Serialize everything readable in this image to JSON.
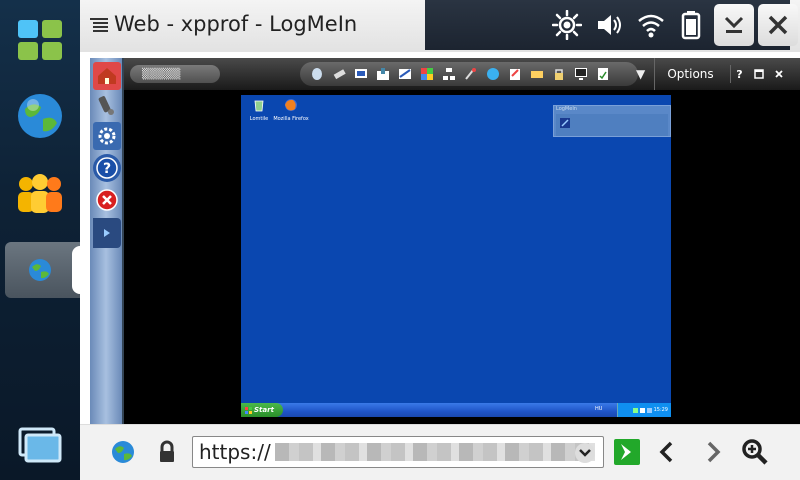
{
  "window": {
    "title": "Web - xpprof - LogMeIn"
  },
  "colors": {
    "xp_desktop": "#0a47b0",
    "xp_start": "#2a8f2a",
    "go_button": "#22a82a"
  },
  "dock": {
    "items": [
      {
        "name": "app-launcher-icon"
      },
      {
        "name": "web-globe-icon"
      },
      {
        "name": "contacts-icon"
      },
      {
        "name": "active-browser-task-icon"
      },
      {
        "name": "task-switcher-icon"
      }
    ]
  },
  "logmein": {
    "host_label": "▒▒▒▒▒",
    "options_label": "Options",
    "help_label": "?",
    "dropdown_glyph": "▼",
    "side_buttons": [
      "home-icon",
      "remote-control-icon",
      "preferences-icon",
      "help-icon",
      "disconnect-icon"
    ],
    "toolbar_icons": [
      "mouse-icon",
      "eraser-icon",
      "screen-icon",
      "zoom-icon",
      "display-icon",
      "color-icon",
      "network-icon",
      "pen-icon",
      "chat-icon",
      "clipboard-icon",
      "keyboard-icon",
      "lock-icon",
      "monitor-icon",
      "notes-icon"
    ]
  },
  "remote": {
    "desktop_icons": [
      {
        "label": "Lomtile"
      },
      {
        "label": "Mozilla Firefox"
      }
    ],
    "window_title": "LogMeIn",
    "start_label": "Start",
    "lang": "HU",
    "clock": "15:29"
  },
  "urlbar": {
    "protocol": "https://"
  }
}
